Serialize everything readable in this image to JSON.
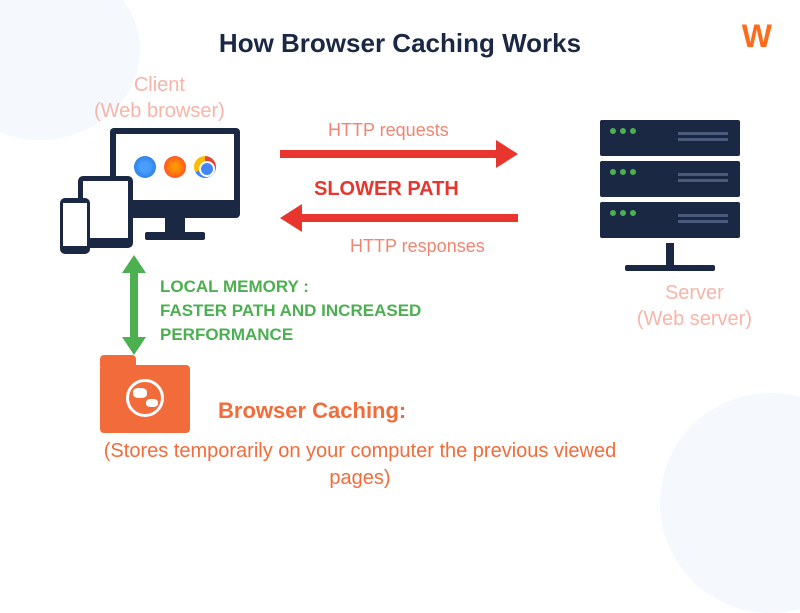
{
  "title": "How Browser Caching Works",
  "logo": "W",
  "client": {
    "line1": "Client",
    "line2": "(Web browser)"
  },
  "server": {
    "line1": "Server",
    "line2": "(Web server)"
  },
  "http_requests": "HTTP requests",
  "http_responses": "HTTP responses",
  "slower_path": "SLOWER PATH",
  "local_memory": {
    "line1": "LOCAL MEMORY :",
    "line2": "FASTER PATH AND INCREASED",
    "line3": "PERFORMANCE"
  },
  "caching": {
    "title": "Browser Caching:",
    "desc": "(Stores temporarily on your computer the previous viewed pages)"
  }
}
